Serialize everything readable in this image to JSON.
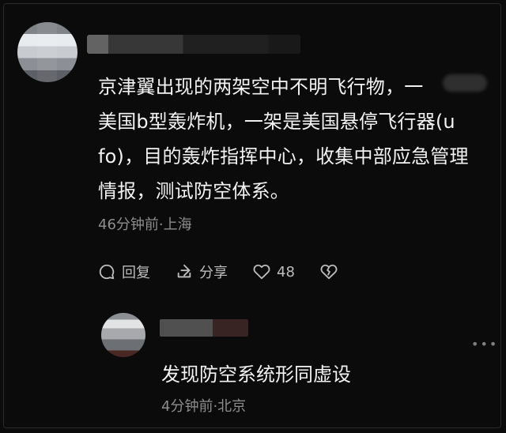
{
  "post": {
    "text": "京津翼出现的两架空中不明飞行物，一\n美国b型轰炸机，一架是美国悬停飞行器(u\nfo)，目的轰炸指挥中心，收集中部应急管理\n情报，测试防空体系。",
    "meta": "46分钟前·上海",
    "actions": {
      "reply_label": "回复",
      "share_label": "分享",
      "like_count": "48"
    }
  },
  "reply": {
    "text": "发现防空系统形同虚设",
    "meta": "4分钟前·北京"
  },
  "icons": {
    "reply": "comment-bubble-icon",
    "share": "share-arrow-icon",
    "like": "heart-icon",
    "dislike": "broken-heart-icon",
    "more": "more-dots-icon"
  },
  "colors": {
    "background": "#0b0b0b",
    "text": "#f2f2f2",
    "meta": "#8d8d8d"
  }
}
